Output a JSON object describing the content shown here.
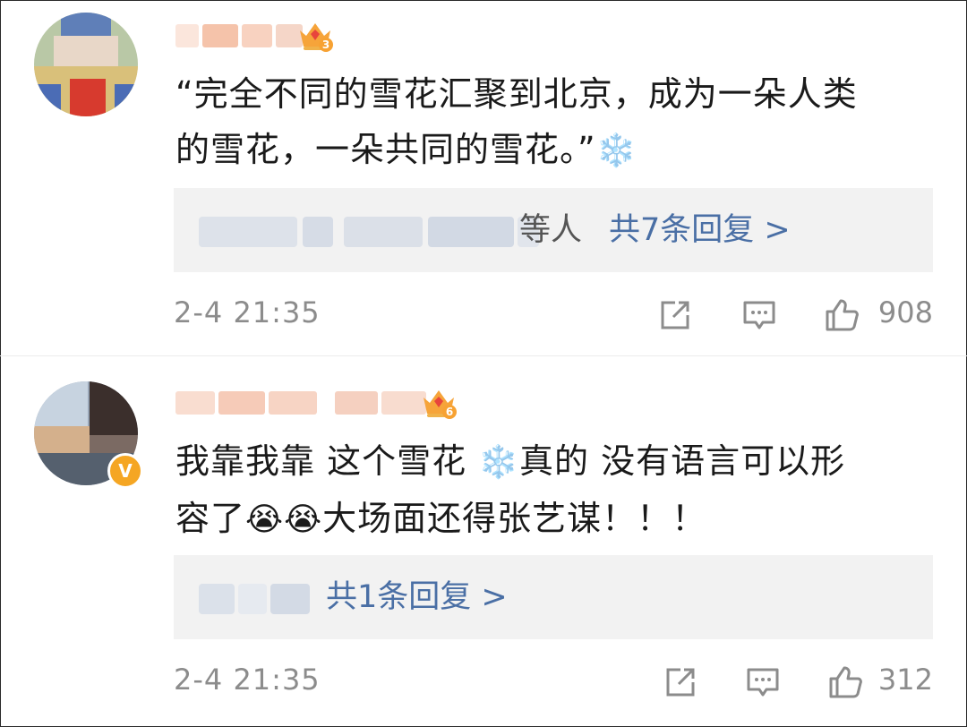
{
  "comments": [
    {
      "level": "3",
      "text_line1": "“完全不同的雪花汇聚到北京，成为一朵人类",
      "text_line2": "的雪花，一朵共同的雪花。”",
      "emoji_snowflake": "❄️",
      "reply_prefix": "等人",
      "reply_count": "共7条回复 >",
      "time": "2-4 21:35",
      "likes": "908",
      "icons": [
        "share-icon",
        "comment-icon",
        "like-icon"
      ]
    },
    {
      "level": "6",
      "verified_badge": "V",
      "text_part1": "我靠我靠 这个雪花 ",
      "emoji_snowflake": "❄️",
      "text_part2": "真的 没有语言可以形",
      "text_part3": "容了",
      "emoji_cry": "😭",
      "text_part4": "大场面还得张艺谋！！！",
      "reply_count": "共1条回复 >",
      "time": "2-4 21:35",
      "likes": "312",
      "icons": [
        "share-icon",
        "comment-icon",
        "like-icon"
      ]
    }
  ],
  "colors": {
    "link_blue": "#4a6fa5",
    "meta_gray": "#8c8c8c",
    "reply_bg": "#f2f2f2",
    "badge_orange": "#f5a623"
  }
}
